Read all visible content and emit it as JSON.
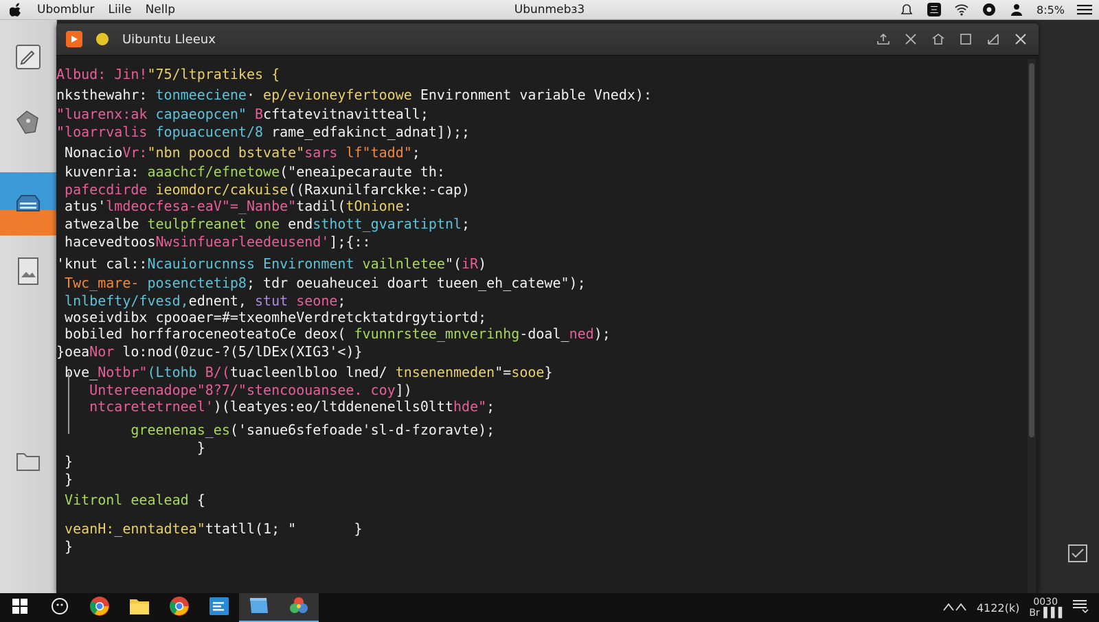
{
  "menubar": {
    "menus": [
      "Ubomblur",
      "Liile",
      "Nellp"
    ],
    "center_title": "Ubunmebз3",
    "battery": "8:5%"
  },
  "window": {
    "title": "Uibuntu Lleeux"
  },
  "terminal": {
    "lines": [
      {
        "segs": [
          {
            "t": "Albud: ",
            "c": "pink"
          },
          {
            "t": "Jin!",
            "c": "pink"
          },
          {
            "t": "\"75/ltpratikes {",
            "c": "yellow"
          }
        ]
      },
      {
        "segs": [
          {
            "t": "nksthewahr: ",
            "c": "white"
          },
          {
            "t": "tonmeeciene",
            "c": "cyan"
          },
          {
            "t": "· ",
            "c": "white"
          },
          {
            "t": "ep/evioneyfertoowe",
            "c": "yellow"
          },
          {
            "t": " Environment variable Vnedx):",
            "c": "white"
          }
        ]
      },
      {
        "segs": [
          {
            "t": "\"luarenx:ak ",
            "c": "pink"
          },
          {
            "t": "capaeopcen\" ",
            "c": "cyan"
          },
          {
            "t": "B",
            "c": "pink"
          },
          {
            "t": "cftatevitnavitteall;",
            "c": "white"
          }
        ]
      },
      {
        "segs": [
          {
            "t": "\"loarrvalis ",
            "c": "pink"
          },
          {
            "t": "fopuacucent/8 ",
            "c": "cyan"
          },
          {
            "t": "rame_edfakinct_adnat]",
            "c": "white"
          },
          {
            "t": ");;",
            "c": "white"
          }
        ]
      },
      {
        "segs": [
          {
            "t": " Nonacio",
            "c": "white"
          },
          {
            "t": "Vr:",
            "c": "pink"
          },
          {
            "t": "\"nbn poocd bstvate\"",
            "c": "yellow"
          },
          {
            "t": "sars ",
            "c": "pink"
          },
          {
            "t": "lf\"tadd\"",
            "c": "orange"
          },
          {
            "t": ";",
            "c": "white"
          }
        ]
      },
      {
        "segs": [
          {
            "t": " kuvenria: ",
            "c": "white"
          },
          {
            "t": "aaachcf/efnetowe",
            "c": "green"
          },
          {
            "t": "(\"eneaipecaraute th:",
            "c": "white"
          }
        ]
      },
      {
        "segs": [
          {
            "t": " pafecdirde ",
            "c": "pink"
          },
          {
            "t": "ieomdorc/cakuise",
            "c": "yellow"
          },
          {
            "t": "((Raxunilfarckke:-cap)",
            "c": "white"
          }
        ]
      },
      {
        "segs": [
          {
            "t": " atus'",
            "c": "white"
          },
          {
            "t": "lmdeocfesa-eaV\"=_Nanbe\"",
            "c": "pink"
          },
          {
            "t": "tadil(",
            "c": "white"
          },
          {
            "t": "tOnione",
            "c": "yellow"
          },
          {
            "t": ":",
            "c": "white"
          }
        ]
      },
      {
        "segs": [
          {
            "t": " atwezalbe ",
            "c": "white"
          },
          {
            "t": "teulpfreanet one ",
            "c": "green"
          },
          {
            "t": "end",
            "c": "white"
          },
          {
            "t": "sthott_gvaratiptnl",
            "c": "cyan"
          },
          {
            "t": ";",
            "c": "white"
          }
        ]
      },
      {
        "segs": [
          {
            "t": " hacevedtoos",
            "c": "white"
          },
          {
            "t": "Nwsinfuearleedeusend'",
            "c": "pink"
          },
          {
            "t": "];{::",
            "c": "white"
          }
        ]
      },
      {
        "segs": [
          {
            "t": "'knut cal::",
            "c": "white"
          },
          {
            "t": "Ncauiorucnnss ",
            "c": "cyan"
          },
          {
            "t": "Environment ",
            "c": "cyan"
          },
          {
            "t": "vailnletee",
            "c": "green"
          },
          {
            "t": "\"(",
            "c": "white"
          },
          {
            "t": "iR",
            "c": "pink"
          },
          {
            "t": ")",
            "c": "white"
          }
        ]
      },
      {
        "segs": [
          {
            "t": " Twc_mare- ",
            "c": "orange"
          },
          {
            "t": "posenctetip8",
            "c": "cyan"
          },
          {
            "t": "; tdr oeuaheucei doart tueen_eh_catewe\");",
            "c": "white"
          }
        ]
      },
      {
        "segs": [
          {
            "t": " lnlbefty/fvesd,",
            "c": "cyan"
          },
          {
            "t": "ednent, ",
            "c": "white"
          },
          {
            "t": "stut ",
            "c": "purple"
          },
          {
            "t": "seone",
            "c": "pink"
          },
          {
            "t": ";",
            "c": "white"
          }
        ]
      },
      {
        "segs": [
          {
            "t": " woseivdibx cpooaer=#=txeomheVerdretcktatdrgytiortd",
            "c": "white"
          },
          {
            "t": ";",
            "c": "white"
          }
        ]
      },
      {
        "segs": [
          {
            "t": " bobiled horffaroceneoteatoCe deox( ",
            "c": "white"
          },
          {
            "t": "fvunnrstee_mnverinhg",
            "c": "green"
          },
          {
            "t": "-doal_",
            "c": "white"
          },
          {
            "t": "ned",
            "c": "pink"
          },
          {
            "t": ");",
            "c": "white"
          }
        ]
      },
      {
        "segs": [
          {
            "t": "}oea",
            "c": "white"
          },
          {
            "t": "Nor ",
            "c": "pink"
          },
          {
            "t": "lo:nod(0zuc-?(5/lDEx(XIG3'<)",
            "c": "white"
          },
          {
            "t": "}",
            "c": "white"
          }
        ]
      },
      {
        "segs": [
          {
            "t": " bve_",
            "c": "white"
          },
          {
            "t": "Notbr\"",
            "c": "pink"
          },
          {
            "t": "(Ltohb ",
            "c": "cyan"
          },
          {
            "t": "B/(",
            "c": "pink"
          },
          {
            "t": "tuacleenlbloo lned/ ",
            "c": "white"
          },
          {
            "t": "tnsenenmeden",
            "c": "yellow"
          },
          {
            "t": "\"=",
            "c": "white"
          },
          {
            "t": "sooe",
            "c": "yellow"
          },
          {
            "t": "}",
            "c": "white"
          }
        ]
      },
      {
        "segs": [
          {
            "t": "    Untereenadope\"8?7/\"stencoouansee. coy",
            "c": "pink"
          },
          {
            "t": "])",
            "c": "white"
          }
        ]
      },
      {
        "segs": [
          {
            "t": "    ntcaretetrneel'",
            "c": "pink"
          },
          {
            "t": ")(leatyes:",
            "c": "white"
          },
          {
            "t": "eo/ltddenenel",
            "c": "white"
          },
          {
            "t": "ls0ltt",
            "c": "white"
          },
          {
            "t": "hde\"",
            "c": "pink"
          },
          {
            "t": ";",
            "c": "white"
          }
        ]
      },
      {
        "segs": [
          {
            "t": "         greenenas_es",
            "c": "green"
          },
          {
            "t": "('sanue6sfefoade'sl-d-fzoravte",
            "c": "white"
          },
          {
            "t": ");",
            "c": "white"
          }
        ]
      },
      {
        "segs": [
          {
            "t": "                 }",
            "c": "white"
          }
        ]
      },
      {
        "segs": [
          {
            "t": " }",
            "c": "white"
          }
        ]
      },
      {
        "segs": [
          {
            "t": " }",
            "c": "white"
          }
        ]
      },
      {
        "segs": [
          {
            "t": " Vitronl eealead ",
            "c": "green"
          },
          {
            "t": "{",
            "c": "white"
          }
        ]
      },
      {
        "segs": [
          {
            "t": " veanH:_enntadtea\"",
            "c": "yellow"
          },
          {
            "t": "ttatll(1; \"       }",
            "c": "white"
          }
        ]
      },
      {
        "segs": [
          {
            "t": " }",
            "c": "white"
          }
        ]
      }
    ]
  },
  "taskbar": {
    "tray_text": "4122(k)",
    "clock_time": "0030",
    "clock_label": "Br▐▐▐"
  },
  "colors": {
    "accent_orange": "#ef7b2c",
    "accent_blue": "#3c9ad9",
    "terminal_bg": "#1e1e1e"
  },
  "icons": {
    "dock": [
      "edit-icon",
      "tag-icon",
      "toolbox-icon",
      "document-icon",
      "folder-icon"
    ],
    "taskbar": [
      "windows-start-icon",
      "search-icon",
      "chrome-icon",
      "file-explorer-icon",
      "chrome-icon",
      "terminal-icon",
      "files-icon",
      "photos-icon"
    ]
  }
}
